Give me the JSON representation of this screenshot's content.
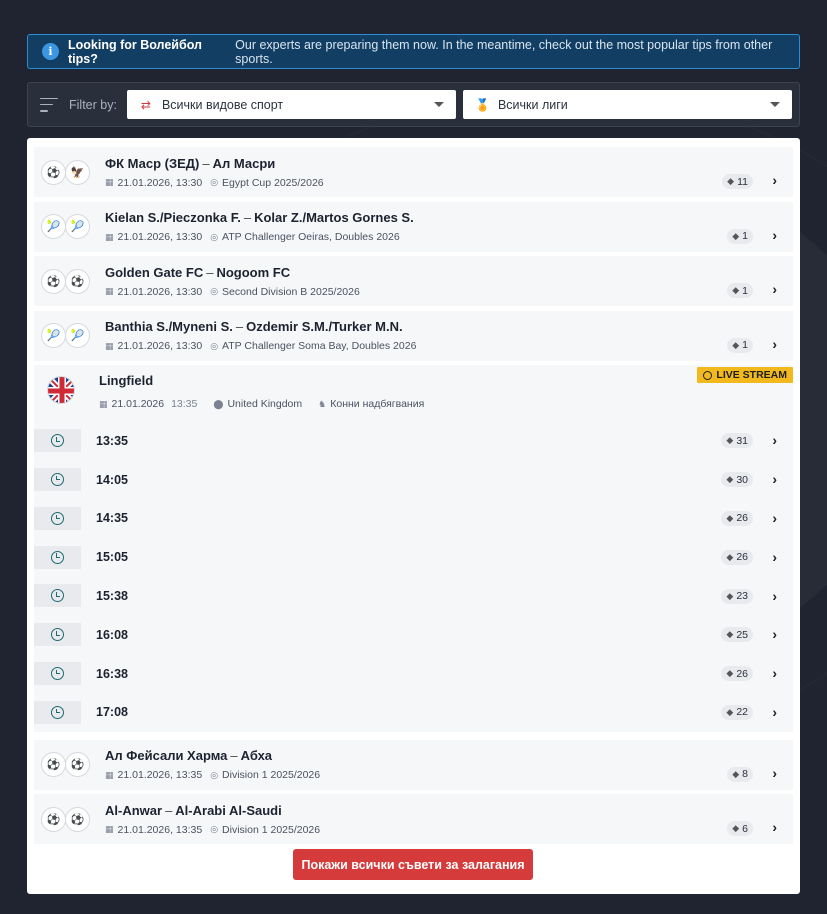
{
  "alert": {
    "bold": "Looking for Волейбол tips?",
    "text": "Our experts are preparing them now. In the meantime, check out the most popular tips from other sports."
  },
  "filter": {
    "label": "Filter by:",
    "sport_value": "Всички видове спорт",
    "league_value": "Всички лиги"
  },
  "events_top": [
    {
      "home": "ФК Маср (ЗЕД)",
      "away": "Ал Масри",
      "date": "21.01.2026, 13:30",
      "competition": "Egypt Cup 2025/2026",
      "tips": "11",
      "home_icon": "⚽",
      "away_icon": "🦅"
    },
    {
      "home": "Kielan S./Pieczonka F.",
      "away": "Kolar Z./Martos Gornes S.",
      "date": "21.01.2026, 13:30",
      "competition": "ATP Challenger Oeiras, Doubles 2026",
      "tips": "1",
      "home_icon": "🎾",
      "away_icon": "🎾"
    },
    {
      "home": "Golden Gate FC",
      "away": "Nogoom FC",
      "date": "21.01.2026, 13:30",
      "competition": "Second Division B 2025/2026",
      "tips": "1",
      "home_icon": "⚽",
      "away_icon": "⚽"
    },
    {
      "home": "Banthia S./Myneni S.",
      "away": "Ozdemir S.M./Turker M.N.",
      "date": "21.01.2026, 13:30",
      "competition": "ATP Challenger Soma Bay, Doubles 2026",
      "tips": "1",
      "home_icon": "🎾",
      "away_icon": "🎾"
    }
  ],
  "racing": {
    "venue": "Lingfield",
    "live_label": "LIVE STREAM",
    "date": "21.01.2026",
    "time": "13:35",
    "country": "United Kingdom",
    "sport": "Конни надбягвания",
    "races": [
      {
        "time": "13:35",
        "tips": "31"
      },
      {
        "time": "14:05",
        "tips": "30"
      },
      {
        "time": "14:35",
        "tips": "26"
      },
      {
        "time": "15:05",
        "tips": "26"
      },
      {
        "time": "15:38",
        "tips": "23"
      },
      {
        "time": "16:08",
        "tips": "25"
      },
      {
        "time": "16:38",
        "tips": "26"
      },
      {
        "time": "17:08",
        "tips": "22"
      }
    ]
  },
  "events_bottom": [
    {
      "home": "Ал Фейсали Харма",
      "away": "Абха",
      "date": "21.01.2026, 13:35",
      "competition": "Division 1 2025/2026",
      "tips": "8",
      "home_icon": "⚽",
      "away_icon": "⚽"
    },
    {
      "home": "Al-Anwar",
      "away": "Al-Arabi Al-Saudi",
      "date": "21.01.2026, 13:35",
      "competition": "Division 1 2025/2026",
      "tips": "6",
      "home_icon": "⚽",
      "away_icon": "⚽"
    }
  ],
  "show_all_label": "Покажи всички съвети за залагания",
  "colors": {
    "accent": "#d63b3b",
    "live": "#f2b91f",
    "info": "#2b8ed3"
  }
}
